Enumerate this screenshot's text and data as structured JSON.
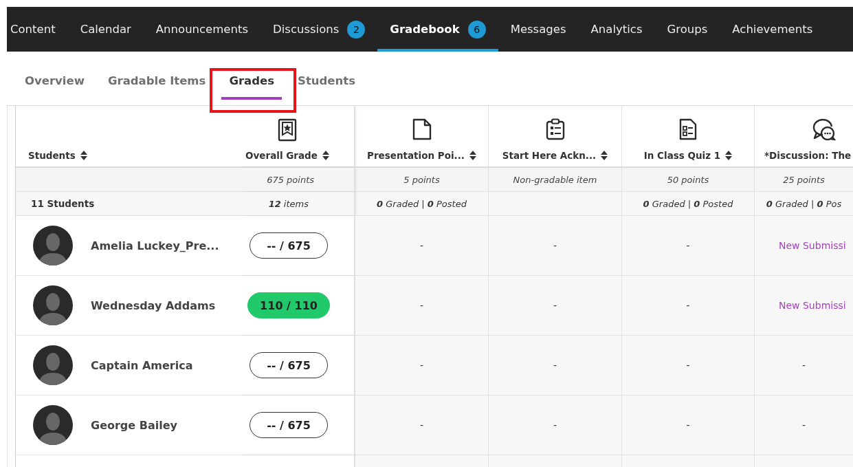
{
  "nav": {
    "items": [
      {
        "label": "Content",
        "selected": false
      },
      {
        "label": "Calendar",
        "selected": false
      },
      {
        "label": "Announcements",
        "selected": false
      },
      {
        "label": "Discussions",
        "badge": "2",
        "selected": false
      },
      {
        "label": "Gradebook",
        "badge": "6",
        "selected": true
      },
      {
        "label": "Messages",
        "selected": false
      },
      {
        "label": "Analytics",
        "selected": false
      },
      {
        "label": "Groups",
        "selected": false
      },
      {
        "label": "Achievements",
        "selected": false
      }
    ]
  },
  "subtabs": [
    {
      "label": "Overview",
      "selected": false,
      "highlighted": false
    },
    {
      "label": "Gradable Items",
      "selected": false,
      "highlighted": false
    },
    {
      "label": "Grades",
      "selected": true,
      "highlighted": true
    },
    {
      "label": "Students",
      "selected": false,
      "highlighted": false
    }
  ],
  "table": {
    "student_column": {
      "label": "Students",
      "summary": "**11** Students"
    },
    "overall_column": {
      "label": "Overall Grade",
      "points": "675 points",
      "summary": "**12** items"
    },
    "columns": [
      {
        "label": "Presentation Poi...",
        "kind": "document",
        "points": "5 points",
        "summary": "**0** Graded | **0** Posted"
      },
      {
        "label": "Start Here Ackn...",
        "kind": "clipboard",
        "points": "Non-gradable item"
      },
      {
        "label": "In Class Quiz 1",
        "kind": "quiz",
        "points": "50 points",
        "summary": "**0** Graded | **0** Posted"
      },
      {
        "label": "*Discussion: The",
        "kind": "discussion",
        "points": "25 points",
        "summary": "**0** Graded | **0** Pos"
      }
    ],
    "rows": [
      {
        "name": "Amelia Luckey_Pre...",
        "grade": "-- / 675",
        "graded": false,
        "cells": [
          {
            "kind": "empty",
            "text": "-"
          },
          {
            "kind": "empty",
            "text": "-"
          },
          {
            "kind": "empty",
            "text": "-"
          },
          {
            "kind": "submission",
            "text": "New Submissi"
          }
        ]
      },
      {
        "name": "Wednesday Addams",
        "grade": "110 / 110",
        "graded": true,
        "cells": [
          {
            "kind": "empty",
            "text": "-"
          },
          {
            "kind": "empty",
            "text": "-"
          },
          {
            "kind": "empty",
            "text": "-"
          },
          {
            "kind": "submission",
            "text": "New Submissi"
          }
        ]
      },
      {
        "name": "Captain America",
        "grade": "-- / 675",
        "graded": false,
        "cells": [
          {
            "kind": "empty",
            "text": "-"
          },
          {
            "kind": "empty",
            "text": "-"
          },
          {
            "kind": "empty",
            "text": "-"
          },
          {
            "kind": "empty",
            "text": "-"
          }
        ]
      },
      {
        "name": "George Bailey",
        "grade": "-- / 675",
        "graded": false,
        "cells": [
          {
            "kind": "empty",
            "text": "-"
          },
          {
            "kind": "empty",
            "text": "-"
          },
          {
            "kind": "empty",
            "text": "-"
          },
          {
            "kind": "empty",
            "text": "-"
          }
        ]
      }
    ]
  }
}
